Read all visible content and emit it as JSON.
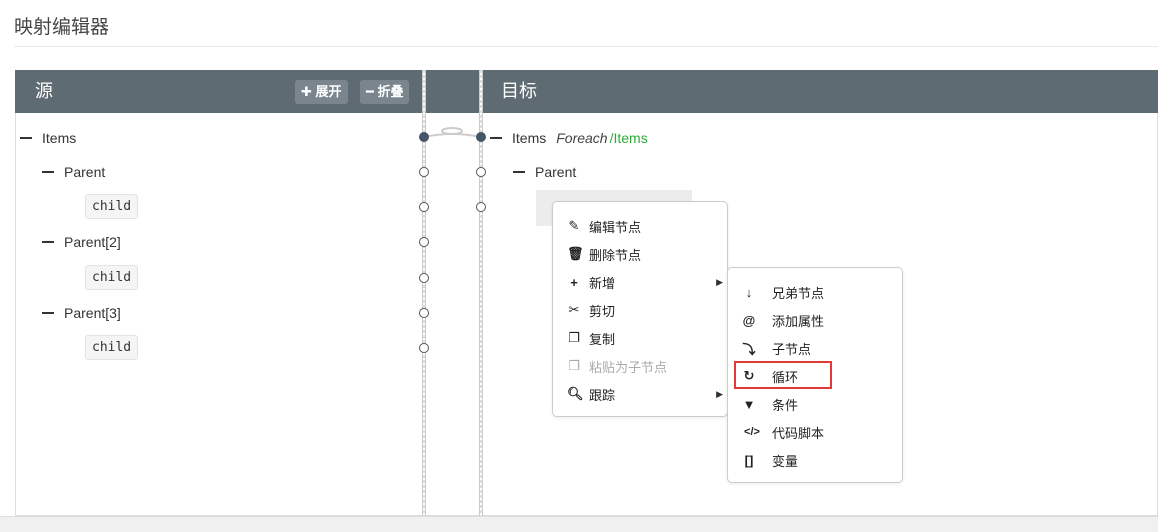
{
  "title": "映射编辑器",
  "source": {
    "header": "源",
    "expand": "展开",
    "collapse": "折叠",
    "nodes": {
      "items": "Items",
      "parent1": "Parent",
      "child1": "child",
      "parent2": "Parent[2]",
      "child2": "child",
      "parent3": "Parent[3]",
      "child3": "child"
    }
  },
  "target": {
    "header": "目标",
    "items": "Items",
    "foreach": "Foreach",
    "path": "/Items",
    "parent": "Parent"
  },
  "context_menu": {
    "items": [
      {
        "label": "编辑节点",
        "icon": "edit-icon"
      },
      {
        "label": "删除节点",
        "icon": "trash-icon"
      },
      {
        "label": "新增",
        "icon": "plus-icon",
        "submenu": true
      },
      {
        "label": "剪切",
        "icon": "scissors-icon"
      },
      {
        "label": "复制",
        "icon": "copy-icon"
      },
      {
        "label": "粘贴为子节点",
        "icon": "paste-icon",
        "disabled": true
      },
      {
        "label": "跟踪",
        "icon": "search-icon",
        "submenu": true
      }
    ]
  },
  "submenu": {
    "items": [
      {
        "label": "兄弟节点",
        "icon": "arrow-down-icon"
      },
      {
        "label": "添加属性",
        "icon": "at-icon"
      },
      {
        "label": "子节点",
        "icon": "child-arrow-icon"
      },
      {
        "label": "循环",
        "icon": "redo-icon",
        "highlighted": true
      },
      {
        "label": "条件",
        "icon": "filter-icon"
      },
      {
        "label": "代码脚本",
        "icon": "code-icon"
      },
      {
        "label": "变量",
        "icon": "brackets-icon"
      }
    ]
  },
  "colors": {
    "header": "#5f6b73",
    "highlight": "#e53935",
    "path": "#2eaa3c"
  }
}
